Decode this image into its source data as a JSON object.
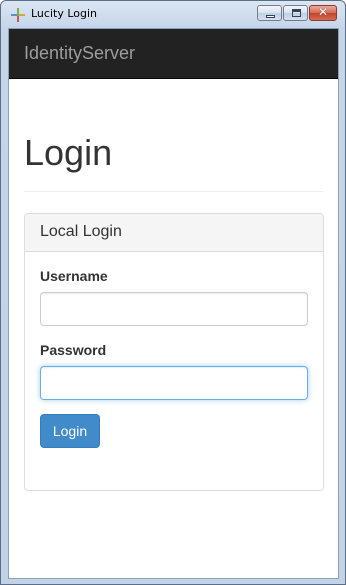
{
  "window": {
    "title": "Lucity Login",
    "controls": {
      "close_glyph": "✕"
    }
  },
  "navbar": {
    "brand": "IdentityServer"
  },
  "page": {
    "title": "Login"
  },
  "panel": {
    "title": "Local Login",
    "fields": {
      "username_label": "Username",
      "username_value": "",
      "password_label": "Password",
      "password_value": ""
    },
    "submit_label": "Login"
  },
  "colors": {
    "navbar_bg": "#222222",
    "brand_text": "#9d9d9d",
    "primary_button": "#428bca",
    "focus_border": "#66afe9"
  },
  "icons": {
    "app": "lucity-cross-icon",
    "minimize": "minimize-icon",
    "maximize": "maximize-icon",
    "close": "close-icon"
  }
}
